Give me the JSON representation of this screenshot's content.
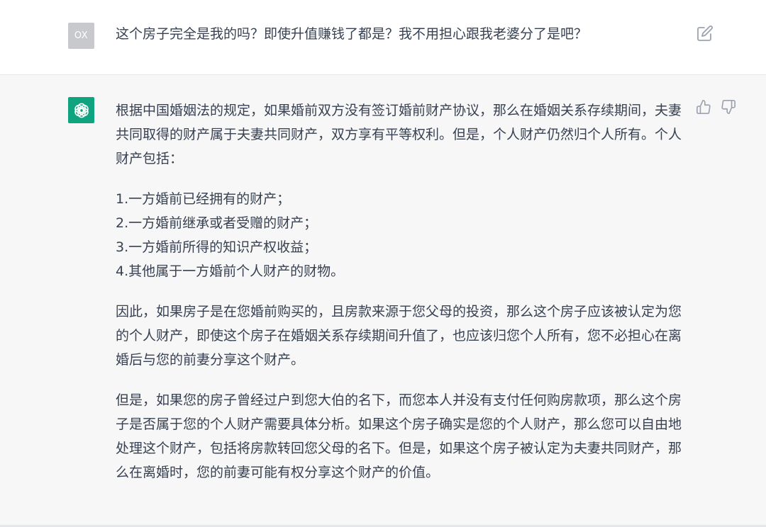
{
  "user": {
    "avatar_text": "OX",
    "message": "这个房子完全是我的吗？即使升值赚钱了都是？我不用担心跟我老婆分了是吧？"
  },
  "assistant": {
    "paragraph_1": "根据中国婚姻法的规定，如果婚前双方没有签订婚前财产协议，那么在婚姻关系存续期间，夫妻共同取得的财产属于夫妻共同财产，双方享有平等权利。但是，个人财产仍然归个人所有。个人财产包括：",
    "list": [
      "1.一方婚前已经拥有的财产；",
      "2.一方婚前继承或者受赠的财产；",
      "3.一方婚前所得的知识产权收益；",
      "4.其他属于一方婚前个人财产的财物。"
    ],
    "paragraph_2": "因此，如果房子是在您婚前购买的，且房款来源于您父母的投资，那么这个房子应该被认定为您的个人财产，即使这个房子在婚姻关系存续期间升值了，也应该归您个人所有，您不必担心在离婚后与您的前妻分享这个财产。",
    "paragraph_3": "但是，如果您的房子曾经过户到您大伯的名下，而您本人并没有支付任何购房款项，那么这个房子是否属于您的个人财产需要具体分析。如果这个房子确实是您的个人财产，那么您可以自由地处理这个财产，包括将房款转回您父母的名下。但是，如果这个房子被认定为夫妻共同财产，那么在离婚时，您的前妻可能有权分享这个财产的价值。"
  },
  "icons": {
    "edit": "edit-icon",
    "thumbs_up": "thumbs-up-icon",
    "thumbs_down": "thumbs-down-icon",
    "gpt_logo": "openai-logo-icon"
  },
  "colors": {
    "assistant_background": "#f7f7f8",
    "brand_green": "#10a37f",
    "user_avatar": "#c7c9cd",
    "text": "#374151",
    "icon": "#9ca3af"
  }
}
